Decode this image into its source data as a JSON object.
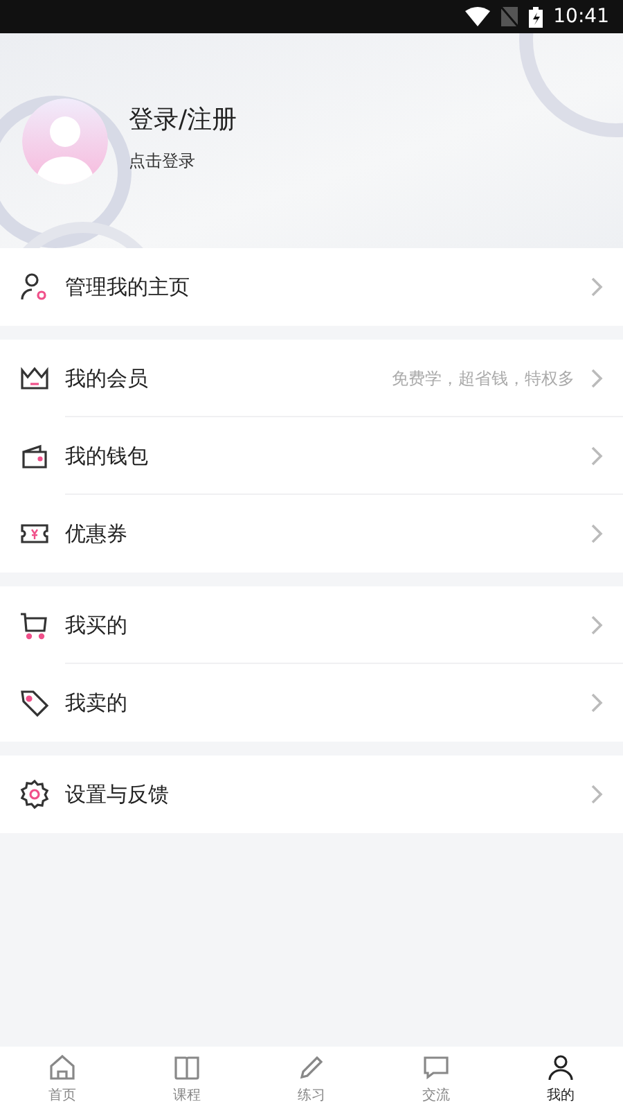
{
  "status_bar": {
    "time": "10:41"
  },
  "profile": {
    "title": "登录/注册",
    "subtitle": "点击登录"
  },
  "sections": [
    {
      "items": [
        {
          "kind": "profile",
          "label": "管理我的主页"
        }
      ]
    },
    {
      "items": [
        {
          "kind": "member",
          "label": "我的会员",
          "hint": "免费学，超省钱，特权多"
        },
        {
          "kind": "wallet",
          "label": "我的钱包"
        },
        {
          "kind": "coupon",
          "label": "优惠券"
        }
      ]
    },
    {
      "items": [
        {
          "kind": "cart",
          "label": "我买的"
        },
        {
          "kind": "tag",
          "label": "我卖的"
        }
      ]
    },
    {
      "items": [
        {
          "kind": "settings",
          "label": "设置与反馈"
        }
      ]
    }
  ],
  "tabs": [
    {
      "kind": "home",
      "label": "首页",
      "selected": false
    },
    {
      "kind": "course",
      "label": "课程",
      "selected": false
    },
    {
      "kind": "practice",
      "label": "练习",
      "selected": false
    },
    {
      "kind": "chat",
      "label": "交流",
      "selected": false
    },
    {
      "kind": "me",
      "label": "我的",
      "selected": true
    }
  ]
}
